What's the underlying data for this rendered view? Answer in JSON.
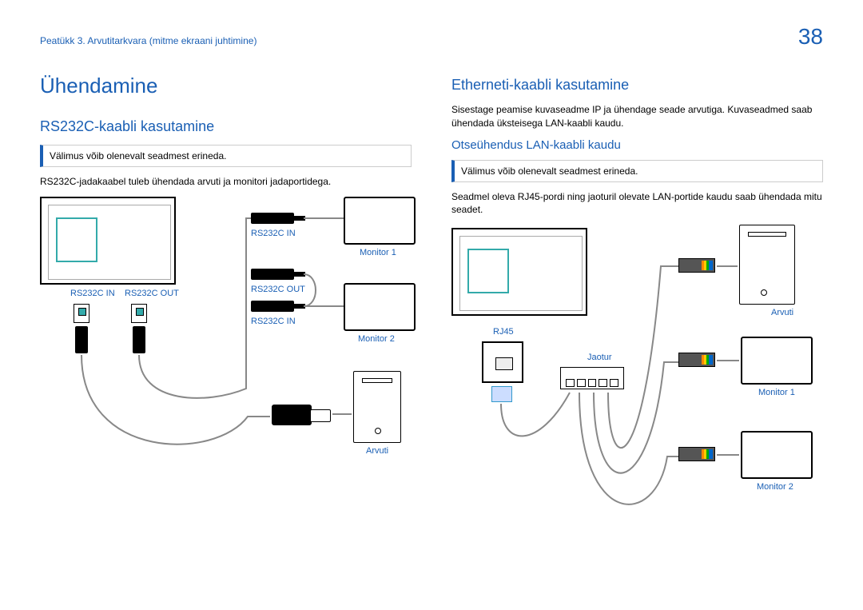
{
  "header": {
    "breadcrumb": "Peatükk 3. Arvutitarkvara (mitme ekraani juhtimine)",
    "page_number": "38"
  },
  "left": {
    "h1": "Ühendamine",
    "h2": "RS232C-kaabli kasutamine",
    "note": "Välimus võib olenevalt seadmest erineda.",
    "p1": "RS232C-jadakaabel tuleb ühendada arvuti ja monitori jadaportidega.",
    "labels": {
      "rs232c_in": "RS232C IN",
      "rs232c_out": "RS232C OUT",
      "monitor1": "Monitor 1",
      "monitor2": "Monitor 2",
      "arvuti": "Arvuti"
    }
  },
  "right": {
    "h2": "Etherneti-kaabli kasutamine",
    "p1": "Sisestage peamise kuvaseadme IP ja ühendage seade arvutiga. Kuvaseadmed saab ühendada üksteisega LAN-kaabli kaudu.",
    "h3": "Otseühendus LAN-kaabli kaudu",
    "note": "Välimus võib olenevalt seadmest erineda.",
    "p2": "Seadmel oleva RJ45-pordi ning jaoturil olevate LAN-portide kaudu saab ühendada mitu seadet.",
    "labels": {
      "rj45": "RJ45",
      "jaotur": "Jaotur",
      "arvuti": "Arvuti",
      "monitor1": "Monitor 1",
      "monitor2": "Monitor 2"
    }
  }
}
